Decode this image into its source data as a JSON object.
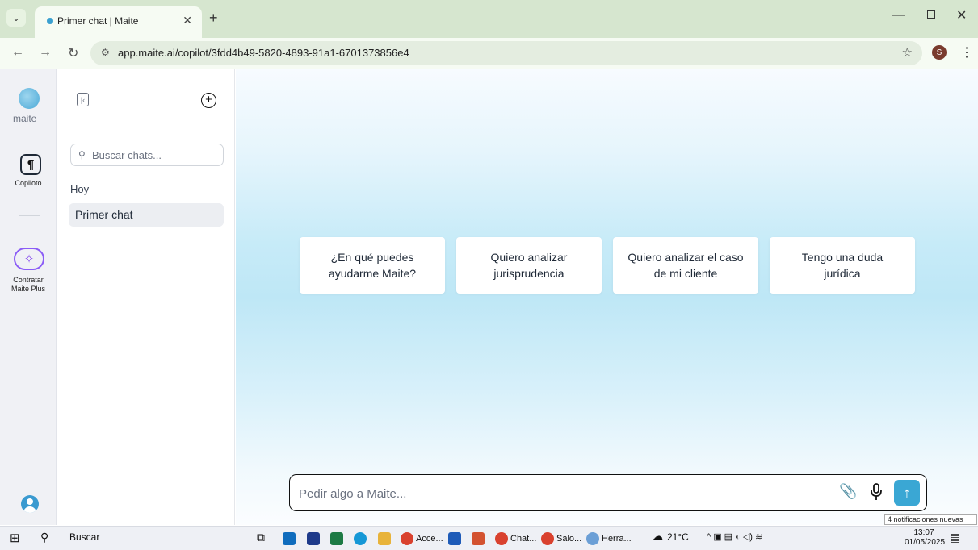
{
  "browser": {
    "tab_title": "Primer chat | Maite",
    "url": "app.maite.ai/copilot/3fdd4b49-5820-4893-91a1-6701373856e4",
    "profile_initial": "S"
  },
  "rail": {
    "logo_text": "maite",
    "copilot_label": "Copiloto",
    "plus_label_line1": "Contratar",
    "plus_label_line2": "Maite Plus"
  },
  "panel": {
    "search_placeholder": "Buscar chats...",
    "group_label": "Hoy",
    "chats": [
      "Primer chat"
    ]
  },
  "main": {
    "suggestions": [
      "¿En qué puedes ayudarme Maite?",
      "Quiero analizar jurisprudencia",
      "Quiero analizar el caso de mi cliente",
      "Tengo una duda jurídica"
    ],
    "prompt_placeholder": "Pedir algo a Maite..."
  },
  "taskbar": {
    "search_label": "Buscar",
    "apps": [
      "Acce...",
      "Chat...",
      "Salo...",
      "Herra..."
    ],
    "weather": "21°C",
    "time": "13:07",
    "date": "01/05/2025",
    "notification_tooltip": "4 notificaciones nuevas",
    "notification_count": "4"
  },
  "colors": {
    "accent": "#3aa7d4",
    "plus_accent": "#8b5cf6"
  }
}
